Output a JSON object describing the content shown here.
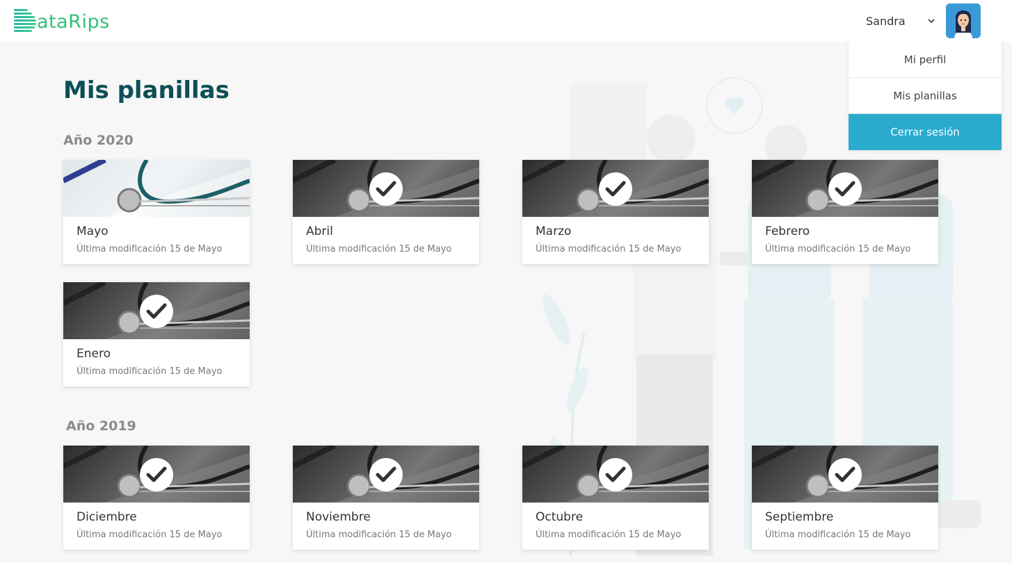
{
  "app": {
    "logo_text": "ataRips"
  },
  "header": {
    "user_name": "Sandra"
  },
  "user_menu": {
    "items": [
      {
        "label": "Mi perfil",
        "active": false
      },
      {
        "label": "Mis planillas",
        "active": false
      },
      {
        "label": "Cerrar sesión",
        "active": true
      }
    ]
  },
  "main": {
    "title": "Mis planillas",
    "years": [
      {
        "label": "Año 2020",
        "cards": [
          {
            "title": "Mayo",
            "subtitle": "Última modificación 15 de Mayo",
            "completed": false
          },
          {
            "title": "Abril",
            "subtitle": "Última modificación 15 de Mayo",
            "completed": true
          },
          {
            "title": "Marzo",
            "subtitle": "Última modificación 15 de Mayo",
            "completed": true
          },
          {
            "title": "Febrero",
            "subtitle": "Última modificación 15 de Mayo",
            "completed": true
          },
          {
            "title": "Enero",
            "subtitle": "Última modificación 15 de Mayo",
            "completed": true
          }
        ]
      },
      {
        "label": "Año 2019",
        "cards": [
          {
            "title": "Diciembre",
            "subtitle": "Última modificación 15 de Mayo",
            "completed": true
          },
          {
            "title": "Noviembre",
            "subtitle": "Última modificación 15 de Mayo",
            "completed": true
          },
          {
            "title": "Octubre",
            "subtitle": "Última modificación 15 de Mayo",
            "completed": true
          },
          {
            "title": "Septiembre",
            "subtitle": "Última modificación 15 de Mayo",
            "completed": true
          }
        ]
      }
    ]
  },
  "colors": {
    "accent": "#2aabce",
    "title": "#0d4f56",
    "logo": "#33c07a"
  },
  "icons": {
    "check": "check-icon",
    "chevron": "chevron-down-icon"
  }
}
